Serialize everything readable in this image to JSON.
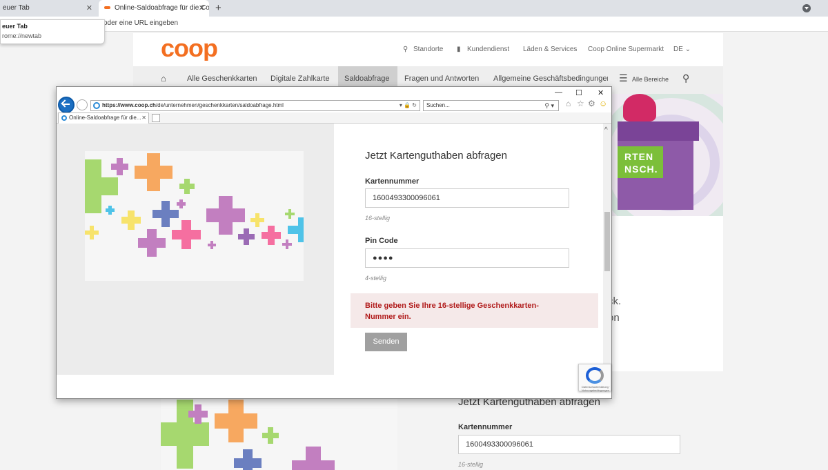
{
  "chrome": {
    "tab1_label": "euer Tab",
    "tab2_label": "Online-Saldoabfrage für die Coop",
    "omnibox_placeholder": "oder eine URL eingeben",
    "dropdown_title": "euer Tab",
    "dropdown_url": "rome://newtab",
    "close_glyph": "✕",
    "new_tab_glyph": "+"
  },
  "coop": {
    "logo_text": "coop",
    "logo_color": "#f36f21",
    "top_links": [
      "Standorte",
      "Kundendienst",
      "Läden & Services",
      "Coop Online Supermarkt",
      "DE"
    ],
    "nav_items": [
      "Alle Geschenkkarten",
      "Digitale Zahlkarte",
      "Saldoabfrage",
      "Fragen und Antworten",
      "Allgemeine Geschäftsbedingungen"
    ],
    "nav_all": "Alle Bereiche",
    "hero_label_line1": "RTEN",
    "hero_label_line2": "NSCH.",
    "bg_text_1": "ck.",
    "bg_text_2": "on",
    "lower_title": "Jetzt Kartenguthaben abfragen",
    "lower_label": "Kartennummer",
    "lower_value": "1600493300096061",
    "lower_hint": "16-stellig"
  },
  "ie": {
    "win_min": "—",
    "win_max": "☐",
    "win_close": "✕",
    "address_host": "https://www.coop.ch",
    "address_path": "/de/unternehmen/geschenkkarten/saldoabfrage.html",
    "address_icons": "▾ 🔒 ↻",
    "search_placeholder": "Suchen...",
    "search_icons": "⚲ ▾",
    "tab_label": "Online-Saldoabfrage für die...",
    "tab_close": "✕",
    "tools": [
      "⌂",
      "☆",
      "⚙",
      "☺"
    ]
  },
  "form": {
    "title": "Jetzt Kartenguthaben abfragen",
    "card_label": "Kartennummer",
    "card_value": "1600493300096061",
    "card_hint": "16-stellig",
    "pin_label": "Pin Code",
    "pin_value": "●●●●",
    "pin_hint": "4-stellig",
    "error": "Bitte geben Sie Ihre 16-stellige Geschenkkarten-Nummer ein.",
    "submit": "Senden",
    "recaptcha_text": "Datenschutzerklärung · Nutzungsbedingungen"
  },
  "colors": {
    "error_text": "#b11c1c",
    "error_bg": "#f5e9e9",
    "button_bg": "#a0a0a0",
    "ie_blue": "#1c6fc2"
  }
}
